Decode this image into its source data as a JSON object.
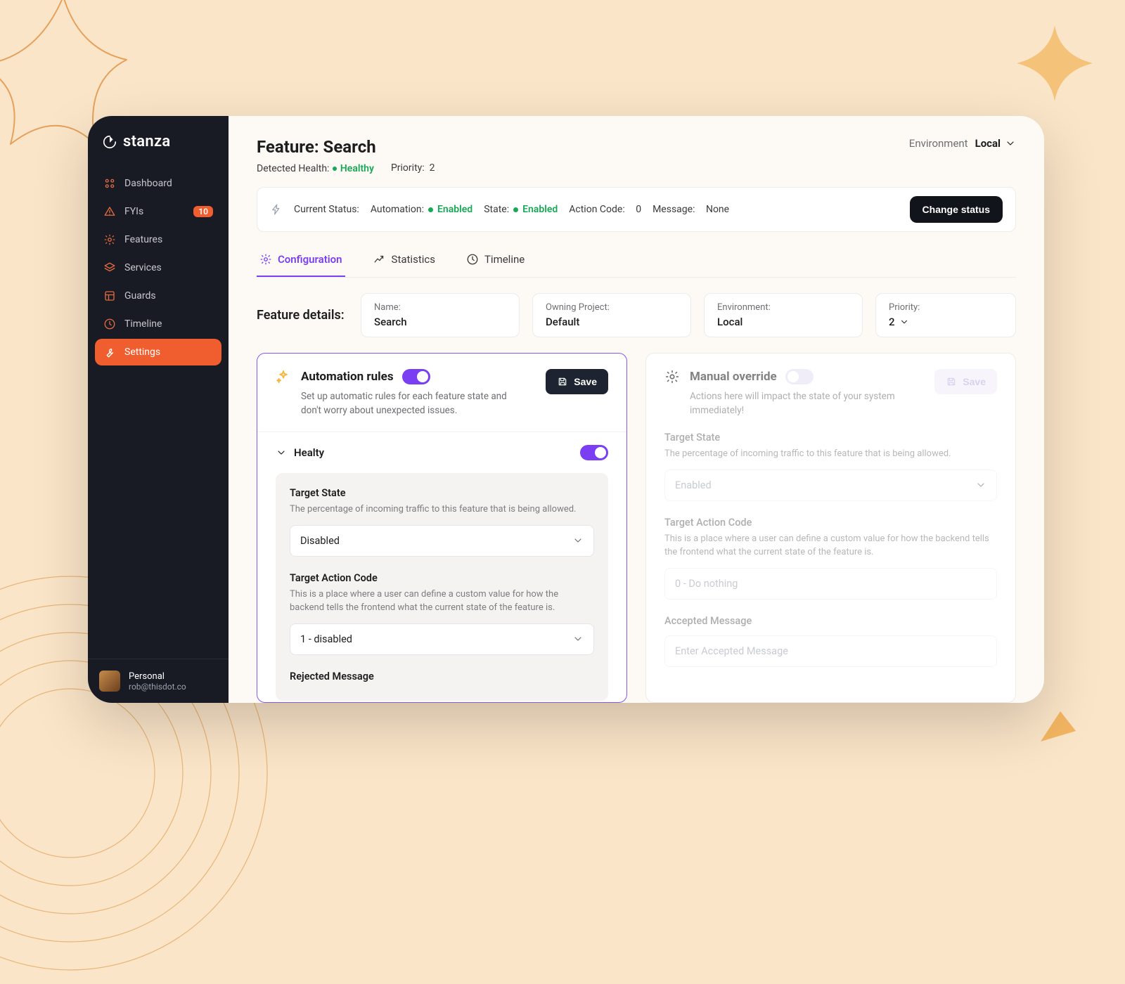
{
  "brand": "stanza",
  "sidebar": {
    "items": [
      {
        "label": "Dashboard"
      },
      {
        "label": "FYIs",
        "badge": "10"
      },
      {
        "label": "Features"
      },
      {
        "label": "Services"
      },
      {
        "label": "Guards"
      },
      {
        "label": "Timeline"
      },
      {
        "label": "Settings"
      }
    ],
    "user": {
      "name": "Personal",
      "email": "rob@thisdot.co"
    }
  },
  "header": {
    "title": "Feature: Search",
    "detected_health_label": "Detected Health:",
    "detected_health_value": "Healthy",
    "priority_label": "Priority:",
    "priority_value": "2",
    "env_label": "Environment",
    "env_value": "Local"
  },
  "status": {
    "current_label": "Current Status:",
    "automation_label": "Automation:",
    "automation_value": "Enabled",
    "state_label": "State:",
    "state_value": "Enabled",
    "action_code_label": "Action Code:",
    "action_code_value": "0",
    "message_label": "Message:",
    "message_value": "None",
    "change_button": "Change status"
  },
  "tabs": {
    "configuration": "Configuration",
    "statistics": "Statistics",
    "timeline": "Timeline"
  },
  "details": {
    "section_label": "Feature details:",
    "name_k": "Name:",
    "name_v": "Search",
    "project_k": "Owning Project:",
    "project_v": "Default",
    "env_k": "Environment:",
    "env_v": "Local",
    "priority_k": "Priority:",
    "priority_v": "2"
  },
  "auto_panel": {
    "title": "Automation rules",
    "desc": "Set up automatic rules for each feature state and don't worry about unexpected issues.",
    "save": "Save",
    "section_label": "Healty",
    "target_state_title": "Target State",
    "target_state_help": "The percentage of incoming traffic to this feature that is being allowed.",
    "target_state_value": "Disabled",
    "action_code_title": "Target Action Code",
    "action_code_help": "This is a place where a user can define a custom value for how the backend tells the frontend what the current state of the feature is.",
    "action_code_value": "1 - disabled",
    "rejected_title": "Rejected Message"
  },
  "manual_panel": {
    "title": "Manual override",
    "desc": "Actions here will impact the state of your system immediately!",
    "save": "Save",
    "target_state_title": "Target State",
    "target_state_help": "The percentage of incoming traffic to this feature that is being allowed.",
    "target_state_value": "Enabled",
    "action_code_title": "Target Action Code",
    "action_code_help": "This is a place where a user can define a custom value for how the backend tells the frontend what the current state of the feature is.",
    "action_code_placeholder": "0 - Do nothing",
    "accepted_title": "Accepted Message",
    "accepted_placeholder": "Enter Accepted Message"
  }
}
